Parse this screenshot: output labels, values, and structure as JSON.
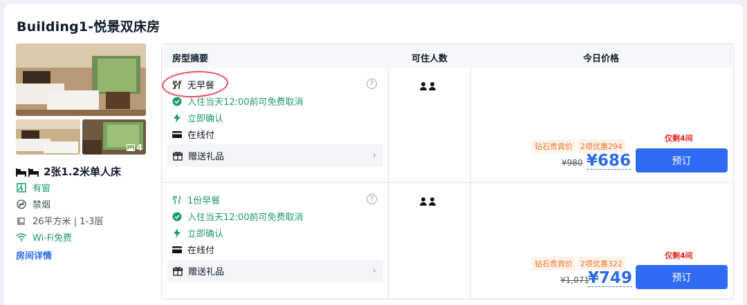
{
  "room": {
    "title": "Building1-悦景双床房",
    "photo_count": "4",
    "bed": "2张1.2米单人床",
    "features": [
      "有窗",
      "禁烟",
      "26平方米 | 1-3层",
      "Wi-Fi免费"
    ],
    "detail_link": "房间详情"
  },
  "table": {
    "headers": [
      "房型摘要",
      "可住人数",
      "今日价格"
    ],
    "rows": [
      {
        "meal": "无早餐",
        "cancel": "入住当天12:00前可免费取消",
        "confirm": "立即确认",
        "pay": "在线付",
        "gift": "赠送礼品",
        "tag_member": "钻石贵宾价",
        "tag_discount": "2项优惠294",
        "original_price": "¥980",
        "price": "¥686",
        "remaining": "仅剩4间",
        "book": "预订"
      },
      {
        "meal": "1份早餐",
        "cancel": "入住当天12:00前可免费取消",
        "confirm": "立即确认",
        "pay": "在线付",
        "gift": "赠送礼品",
        "tag_member": "钻石贵宾价",
        "tag_discount": "2项优惠322",
        "original_price": "¥1,071",
        "price": "¥749",
        "remaining": "仅剩4间",
        "book": "预订"
      }
    ]
  },
  "colors": {
    "accent": "#2f6bf4",
    "green": "#1d9a6c",
    "red": "#e6231e",
    "orange": "#f0712d"
  }
}
